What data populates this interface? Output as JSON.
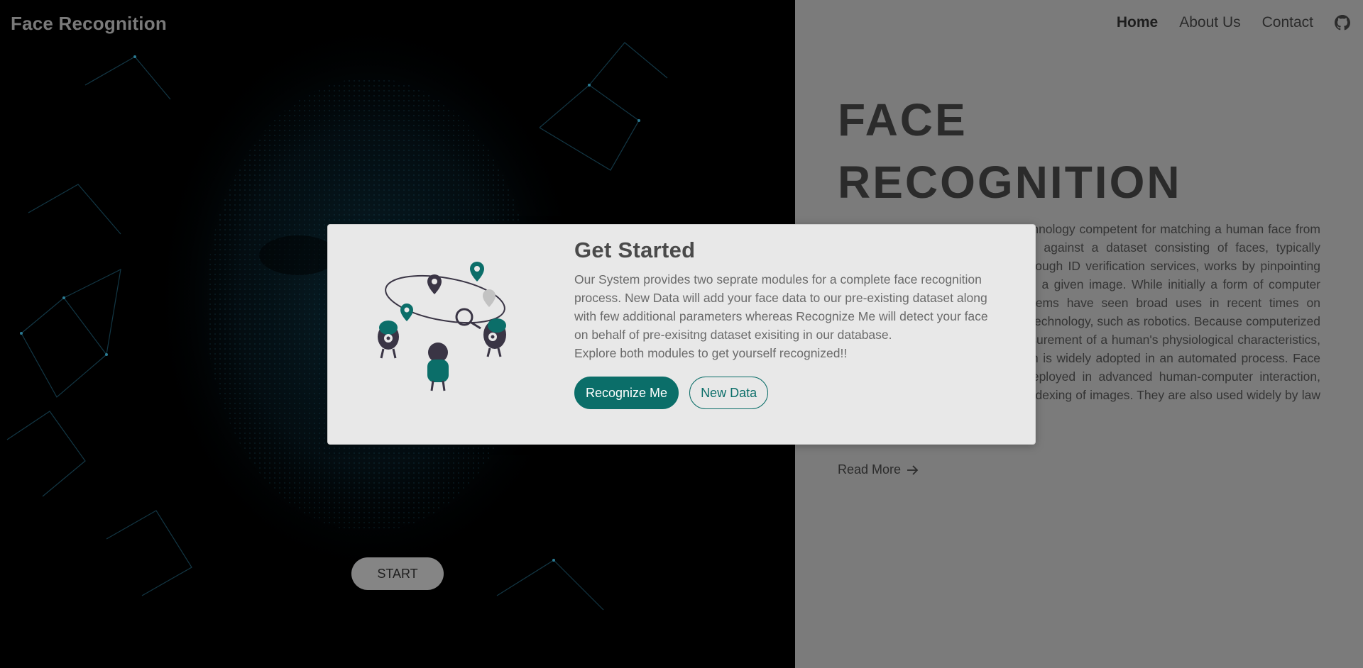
{
  "nav": {
    "brand": "Face Recognition",
    "links": [
      "Home",
      "About Us",
      "Contact"
    ],
    "active": "Home",
    "icon": "github-icon"
  },
  "hero": {
    "title_line1": "FACE",
    "title_line2": "RECOGNITION",
    "text": "A facial recognition system is a technology competent for matching a human face from a digital image or a video frame against a dataset consisting of faces, typically employed to authenticate users through ID verification services, works by pinpointing and measuring facial features from a given image. While initially a form of computer application, facial recognition systems have seen broad uses in recent times on smartphones and in other forms of technology, such as robotics. Because computerized facial recognition involves the measurement of a human's physiological characteristics, though, the face recognition system is widely adopted in an automated process. Face recognition systems have been deployed in advanced human-computer interaction, video surveillance, and automatic indexing of images. They are also used widely by law enforcement agencies.",
    "read_more": "Read More",
    "start": "START"
  },
  "modal": {
    "title": "Get Started",
    "text": "Our System provides two seprate modules for a complete face recognition process. New Data will add your face data to our pre-existing dataset along with few additional parameters whereas Recognize Me will detect your face on behalf of pre-exisitng dataset exisiting in our database.",
    "text2": "Explore both modules to get yourself recognized!!",
    "primary_button": "Recognize Me",
    "secondary_button": "New Data"
  },
  "colors": {
    "accent": "#0b6e69",
    "overlay": "#7b7b7b",
    "modal_bg": "#e8e8e8"
  }
}
